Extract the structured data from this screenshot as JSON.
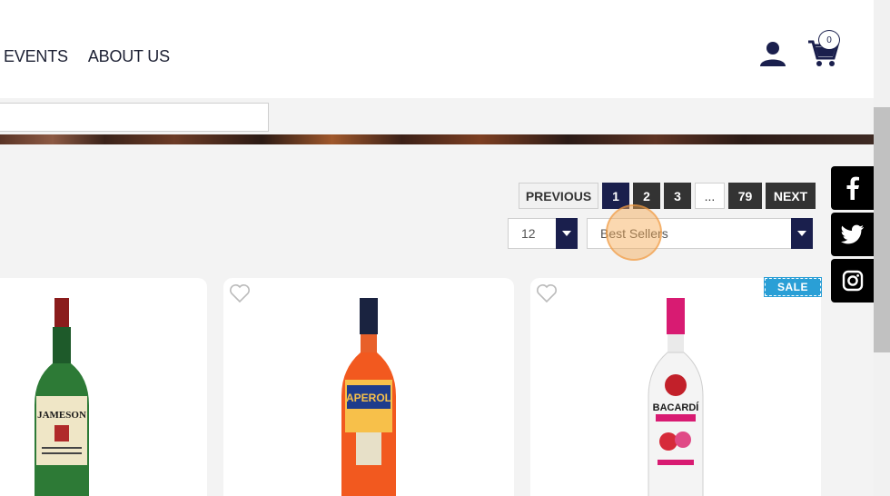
{
  "nav": {
    "items": [
      {
        "label": "EVENTS"
      },
      {
        "label": "ABOUT US"
      }
    ]
  },
  "cart": {
    "count": "0"
  },
  "search": {
    "value": "",
    "placeholder": ""
  },
  "pagination": {
    "previous": "PREVIOUS",
    "pages": [
      "1",
      "2",
      "3"
    ],
    "ellipsis": "...",
    "last": "79",
    "next": "NEXT",
    "active_page": "1"
  },
  "per_page": {
    "selected": "12"
  },
  "sort": {
    "selected": "Best Sellers"
  },
  "products": [
    {
      "name": "Jameson",
      "bottle_label": "JAMESON"
    },
    {
      "name": "Aperol",
      "bottle_label": "APEROL"
    },
    {
      "name": "Bacardi",
      "bottle_label": "BACARDÍ",
      "badge": "SALE"
    }
  ],
  "colors": {
    "primary": "#1a1f4d",
    "dark_button": "#333333",
    "sale": "#2a9fd6",
    "social_bg": "#000000"
  },
  "social": [
    "facebook-icon",
    "twitter-icon",
    "instagram-icon"
  ]
}
